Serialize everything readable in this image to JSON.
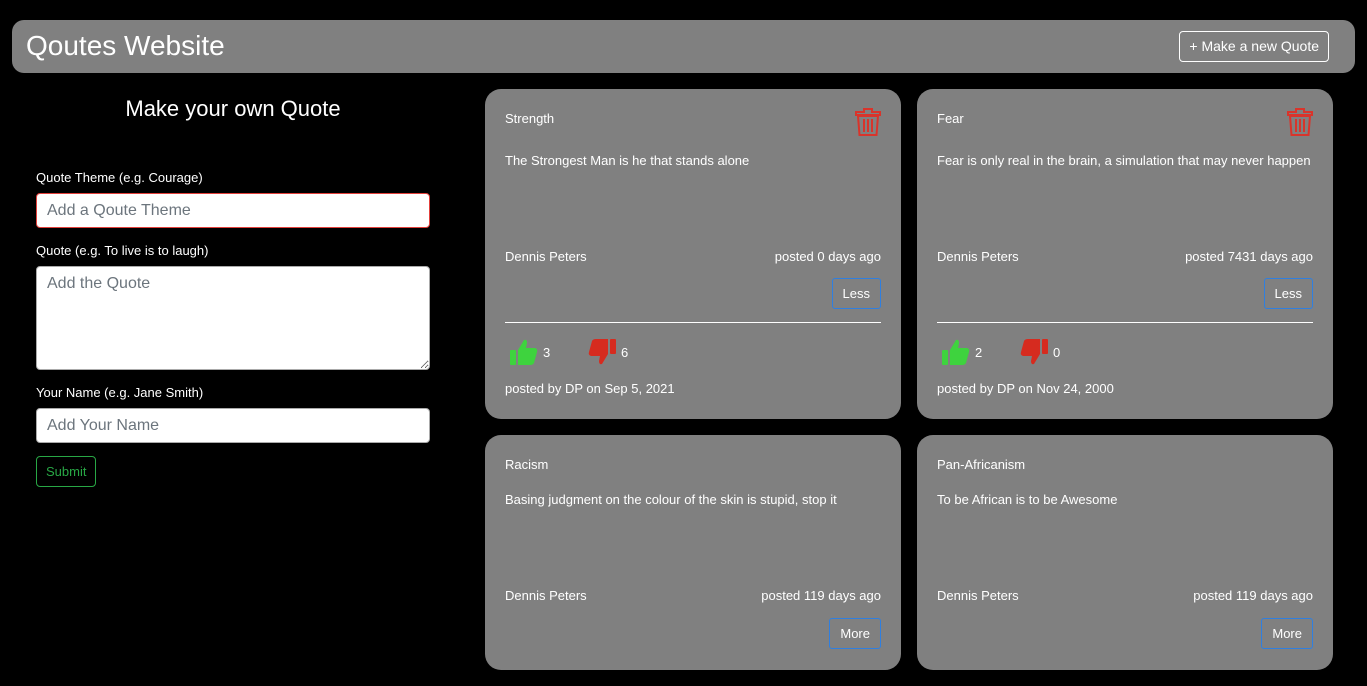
{
  "header": {
    "title": "Qoutes Website",
    "new_quote_label": "+ Make a new Quote"
  },
  "form": {
    "title": "Make your own Quote",
    "theme_label": "Quote Theme (e.g. Courage)",
    "theme_placeholder": "Add a Qoute Theme",
    "quote_label": "Quote (e.g. To live is to laugh)",
    "quote_placeholder": "Add the Quote",
    "name_label": "Your Name (e.g. Jane Smith)",
    "name_placeholder": "Add Your Name",
    "submit_label": "Submit"
  },
  "quotes": [
    {
      "theme": "Strength",
      "text": "The Strongest Man is he that stands alone",
      "author": "Dennis Peters",
      "age": "posted 0 days ago",
      "toggle_label": "Less",
      "likes": "3",
      "dislikes": "6",
      "posted_by": "posted by DP on Sep 5, 2021"
    },
    {
      "theme": "Fear",
      "text": "Fear is only real in the brain, a simulation that may never happen",
      "author": "Dennis Peters",
      "age": "posted 7431 days ago",
      "toggle_label": "Less",
      "likes": "2",
      "dislikes": "0",
      "posted_by": "posted by DP on Nov 24, 2000"
    },
    {
      "theme": "Racism",
      "text": "Basing judgment on the colour of the skin is stupid, stop it",
      "author": "Dennis Peters",
      "age": "posted 119 days ago",
      "toggle_label": "More"
    },
    {
      "theme": "Pan-Africanism",
      "text": "To be African is to be Awesome",
      "author": "Dennis Peters",
      "age": "posted 119 days ago",
      "toggle_label": "More"
    }
  ],
  "colors": {
    "background": "#000000",
    "panel": "#808080",
    "like": "#3ed33e",
    "dislike": "#d62b1f",
    "delete": "#d9342b",
    "toggle_border": "#2f7fe0",
    "submit": "#28a745"
  },
  "icons": {
    "delete": "trash-icon",
    "like": "thumbs-up-icon",
    "dislike": "thumbs-down-icon"
  }
}
